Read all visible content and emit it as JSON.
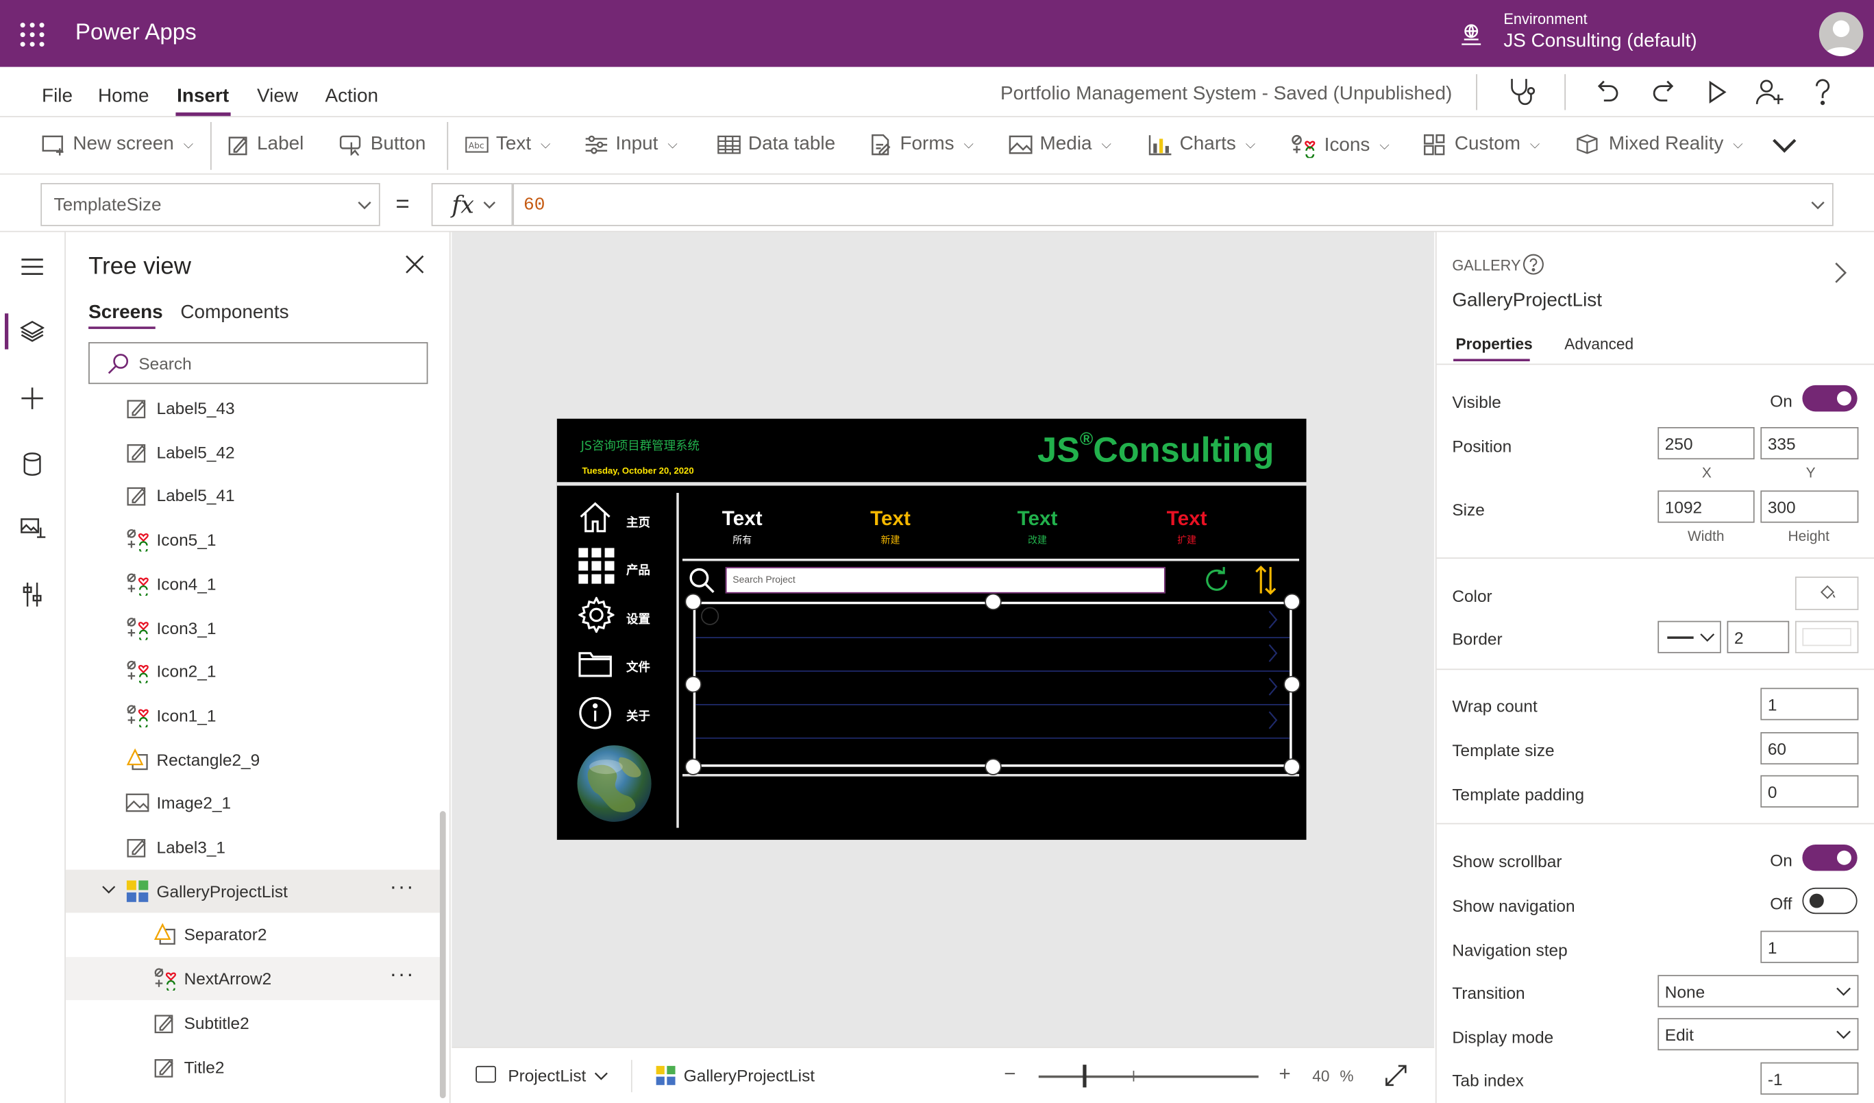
{
  "header": {
    "app_name": "Power Apps",
    "environment_label": "Environment",
    "environment_name": "JS Consulting (default)"
  },
  "menu": {
    "items": [
      "File",
      "Home",
      "Insert",
      "View",
      "Action"
    ],
    "active": "Insert",
    "doc_title": "Portfolio Management System - Saved (Unpublished)"
  },
  "ribbon": {
    "new_screen": "New screen",
    "label": "Label",
    "button": "Button",
    "text": "Text",
    "input": "Input",
    "data_table": "Data table",
    "forms": "Forms",
    "media": "Media",
    "charts": "Charts",
    "icons": "Icons",
    "custom": "Custom",
    "mixed_reality": "Mixed Reality"
  },
  "formula_bar": {
    "property": "TemplateSize",
    "equals": "=",
    "fx": "fx",
    "formula": "60"
  },
  "tree": {
    "title": "Tree view",
    "tabs": [
      "Screens",
      "Components"
    ],
    "active_tab": "Screens",
    "search_placeholder": "Search",
    "items": [
      {
        "label": "Label5_43",
        "icon": "label-icon"
      },
      {
        "label": "Label5_42",
        "icon": "label-icon"
      },
      {
        "label": "Label5_41",
        "icon": "label-icon"
      },
      {
        "label": "Icon5_1",
        "icon": "icons-control-icon"
      },
      {
        "label": "Icon4_1",
        "icon": "icons-control-icon"
      },
      {
        "label": "Icon3_1",
        "icon": "icons-control-icon"
      },
      {
        "label": "Icon2_1",
        "icon": "icons-control-icon"
      },
      {
        "label": "Icon1_1",
        "icon": "icons-control-icon"
      },
      {
        "label": "Rectangle2_9",
        "icon": "shape-icon"
      },
      {
        "label": "Image2_1",
        "icon": "image-icon"
      },
      {
        "label": "Label3_1",
        "icon": "label-icon"
      },
      {
        "label": "GalleryProjectList",
        "icon": "gallery-icon"
      },
      {
        "label": "Separator2",
        "icon": "shape-icon"
      },
      {
        "label": "NextArrow2",
        "icon": "icons-control-icon"
      },
      {
        "label": "Subtitle2",
        "icon": "label-icon"
      },
      {
        "label": "Title2",
        "icon": "label-icon"
      }
    ]
  },
  "app_screen": {
    "title_cn": "JS咨询项目群管理系统",
    "date": "Tuesday, October 20, 2020",
    "logo_js": "JS",
    "logo_reg": "®",
    "logo_consulting": "Consulting",
    "nav": [
      "主页",
      "产品",
      "设置",
      "文件",
      "关于"
    ],
    "tabs": [
      {
        "title": "Text",
        "sub": "所有",
        "color": "#ffffff"
      },
      {
        "title": "Text",
        "sub": "新建",
        "color": "#f5b800"
      },
      {
        "title": "Text",
        "sub": "改建",
        "color": "#22b14c"
      },
      {
        "title": "Text",
        "sub": "扩建",
        "color": "#e81123"
      }
    ],
    "search_placeholder": "Search Project"
  },
  "status": {
    "screen": "ProjectList",
    "selected": "GalleryProjectList",
    "zoom_minus": "−",
    "zoom_plus": "+",
    "zoom": "40",
    "zoom_unit": "%",
    "zoom_fraction": 0.4
  },
  "properties": {
    "type": "GALLERY",
    "name": "GalleryProjectList",
    "tabs": [
      "Properties",
      "Advanced"
    ],
    "active_tab": "Properties",
    "visible_label": "Visible",
    "visible_value": "On",
    "position_label": "Position",
    "position_x": "250",
    "position_y": "335",
    "x_caption": "X",
    "y_caption": "Y",
    "size_label": "Size",
    "width": "1092",
    "height": "300",
    "width_caption": "Width",
    "height_caption": "Height",
    "color_label": "Color",
    "border_label": "Border",
    "border_width": "2",
    "wrap_count_label": "Wrap count",
    "wrap_count": "1",
    "template_size_label": "Template size",
    "template_size": "60",
    "template_padding_label": "Template padding",
    "template_padding": "0",
    "show_scrollbar_label": "Show scrollbar",
    "show_scrollbar": "On",
    "show_navigation_label": "Show navigation",
    "show_navigation": "Off",
    "navigation_step_label": "Navigation step",
    "navigation_step": "1",
    "transition_label": "Transition",
    "transition": "None",
    "display_mode_label": "Display mode",
    "display_mode": "Edit",
    "tab_index_label": "Tab index",
    "tab_index": "-1"
  },
  "colors": {
    "brand": "#742774",
    "app_green": "#22b14c",
    "app_yellow": "#f5b800",
    "app_red": "#e81123"
  }
}
